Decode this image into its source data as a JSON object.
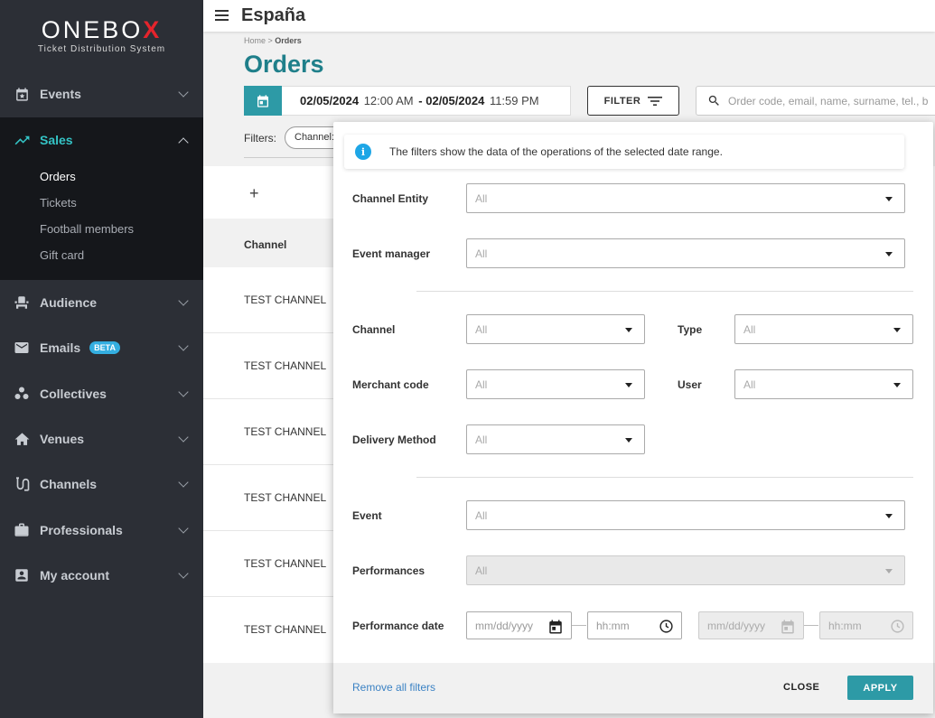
{
  "logo": {
    "main_prefix": "ONEBO",
    "main_x": "X",
    "subtitle": "Ticket Distribution System"
  },
  "sidebar": {
    "items": [
      {
        "label": "Events",
        "icon": "calendar-star-icon"
      },
      {
        "label": "Sales",
        "icon": "trending-up-icon"
      },
      {
        "label": "Audience",
        "icon": "seat-icon"
      },
      {
        "label": "Emails",
        "icon": "envelope-icon",
        "badge": "BETA"
      },
      {
        "label": "Collectives",
        "icon": "group-icon"
      },
      {
        "label": "Venues",
        "icon": "house-icon"
      },
      {
        "label": "Channels",
        "icon": "route-icon"
      },
      {
        "label": "Professionals",
        "icon": "briefcase-icon"
      },
      {
        "label": "My account",
        "icon": "account-box-icon"
      }
    ],
    "sales_sub": [
      "Orders",
      "Tickets",
      "Football members",
      "Gift card"
    ]
  },
  "topbar": {
    "title": "España"
  },
  "breadcrumb": {
    "home": "Home",
    "sep": " > ",
    "current": "Orders"
  },
  "page": {
    "title": "Orders"
  },
  "date_range": {
    "start_date": "02/05/2024",
    "start_time": "12:00 AM",
    "separator": "-",
    "end_date": "02/05/2024",
    "end_time": "11:59 PM"
  },
  "filter_button": {
    "label": "FILTER"
  },
  "search": {
    "placeholder": "Order code, email, name, surname, tel., b"
  },
  "filters_bar": {
    "label": "Filters:",
    "chip": "Channel:"
  },
  "table": {
    "add": "+",
    "columns": [
      "Channel"
    ],
    "rows": [
      "TEST CHANNEL",
      "TEST CHANNEL",
      "TEST CHANNEL",
      "TEST CHANNEL",
      "TEST CHANNEL",
      "TEST CHANNEL"
    ]
  },
  "panel": {
    "info": "The filters show the data of the operations of the selected date range.",
    "info_icon": "i",
    "fields": {
      "channel_entity": {
        "label": "Channel Entity",
        "value": "All"
      },
      "event_manager": {
        "label": "Event manager",
        "value": "All"
      },
      "channel": {
        "label": "Channel",
        "value": "All"
      },
      "type": {
        "label": "Type",
        "value": "All"
      },
      "merchant_code": {
        "label": "Merchant code",
        "value": "All"
      },
      "user": {
        "label": "User",
        "value": "All"
      },
      "delivery_method": {
        "label": "Delivery Method",
        "value": "All"
      },
      "event": {
        "label": "Event",
        "value": "All"
      },
      "performances": {
        "label": "Performances",
        "value": "All"
      },
      "performance_date": {
        "label": "Performance date",
        "date_placeholder": "mm/dd/yyyy",
        "time_placeholder": "hh:mm"
      }
    },
    "footer": {
      "remove": "Remove all filters",
      "close": "CLOSE",
      "apply": "APPLY"
    }
  },
  "colors": {
    "teal": "#2d9aa6",
    "title_teal": "#1f7f8a",
    "sidebar": "#2c2f36",
    "active_nav": "#34c3c5",
    "info_blue": "#1ea6e6",
    "logo_red": "#e5242c"
  }
}
